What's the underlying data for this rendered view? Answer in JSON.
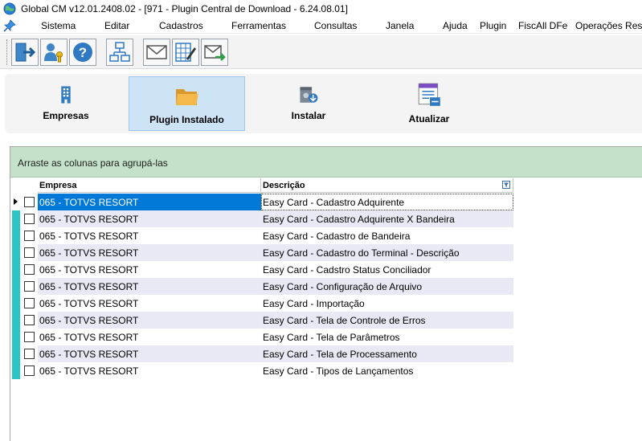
{
  "window": {
    "title": "Global CM v12.01.2408.02 - [971 - Plugin Central de Download - 6.24.08.01]"
  },
  "menu": [
    "Sistema",
    "Editar",
    "Cadastros",
    "Ferramentas",
    "Consultas",
    "Janela",
    "Ajuda",
    "Plugin",
    "FiscAll DFe",
    "Operações Reso"
  ],
  "toolbar": {
    "buttons": [
      "exit-icon",
      "user-key-icon",
      "help-icon",
      "org-chart-icon",
      "mail-icon",
      "edit-grid-icon",
      "mail-send-icon"
    ]
  },
  "ribbon": {
    "buttons": [
      {
        "label": "Empresas",
        "icon": "building-icon"
      },
      {
        "label": "Plugin Instalado",
        "icon": "folder-icon",
        "selected": true
      },
      {
        "label": "Instalar",
        "icon": "install-icon"
      },
      {
        "label": "Atualizar",
        "icon": "update-icon"
      }
    ]
  },
  "grid": {
    "group_hint": "Arraste as colunas para agrupá-las",
    "columns": [
      "Empresa",
      "Descrição"
    ],
    "rows": [
      {
        "empresa": "065 - TOTVS RESORT",
        "descricao": "Easy Card - Cadastro Adquirente"
      },
      {
        "empresa": "065 - TOTVS RESORT",
        "descricao": "Easy Card - Cadastro Adquirente X Bandeira"
      },
      {
        "empresa": "065 - TOTVS RESORT",
        "descricao": "Easy Card - Cadastro de Bandeira"
      },
      {
        "empresa": "065 - TOTVS RESORT",
        "descricao": "Easy Card - Cadastro do Terminal - Descrição"
      },
      {
        "empresa": "065 - TOTVS RESORT",
        "descricao": "Easy Card - Cadstro Status Conciliador"
      },
      {
        "empresa": "065 - TOTVS RESORT",
        "descricao": "Easy Card - Configuração de Arquivo"
      },
      {
        "empresa": "065 - TOTVS RESORT",
        "descricao": "Easy Card - Importação"
      },
      {
        "empresa": "065 - TOTVS RESORT",
        "descricao": "Easy Card - Tela de Controle de Erros"
      },
      {
        "empresa": "065 - TOTVS RESORT",
        "descricao": "Easy Card - Tela de Parâmetros"
      },
      {
        "empresa": "065 - TOTVS RESORT",
        "descricao": "Easy Card - Tela de Processamento"
      },
      {
        "empresa": "065 - TOTVS RESORT",
        "descricao": "Easy Card - Tipos de Lançamentos"
      }
    ]
  },
  "colors": {
    "group_panel": "#c4e2c9",
    "row_indicator": "#2bc4c4",
    "selection": "#0078d7",
    "ribbon_selected": "#cde4f7"
  }
}
